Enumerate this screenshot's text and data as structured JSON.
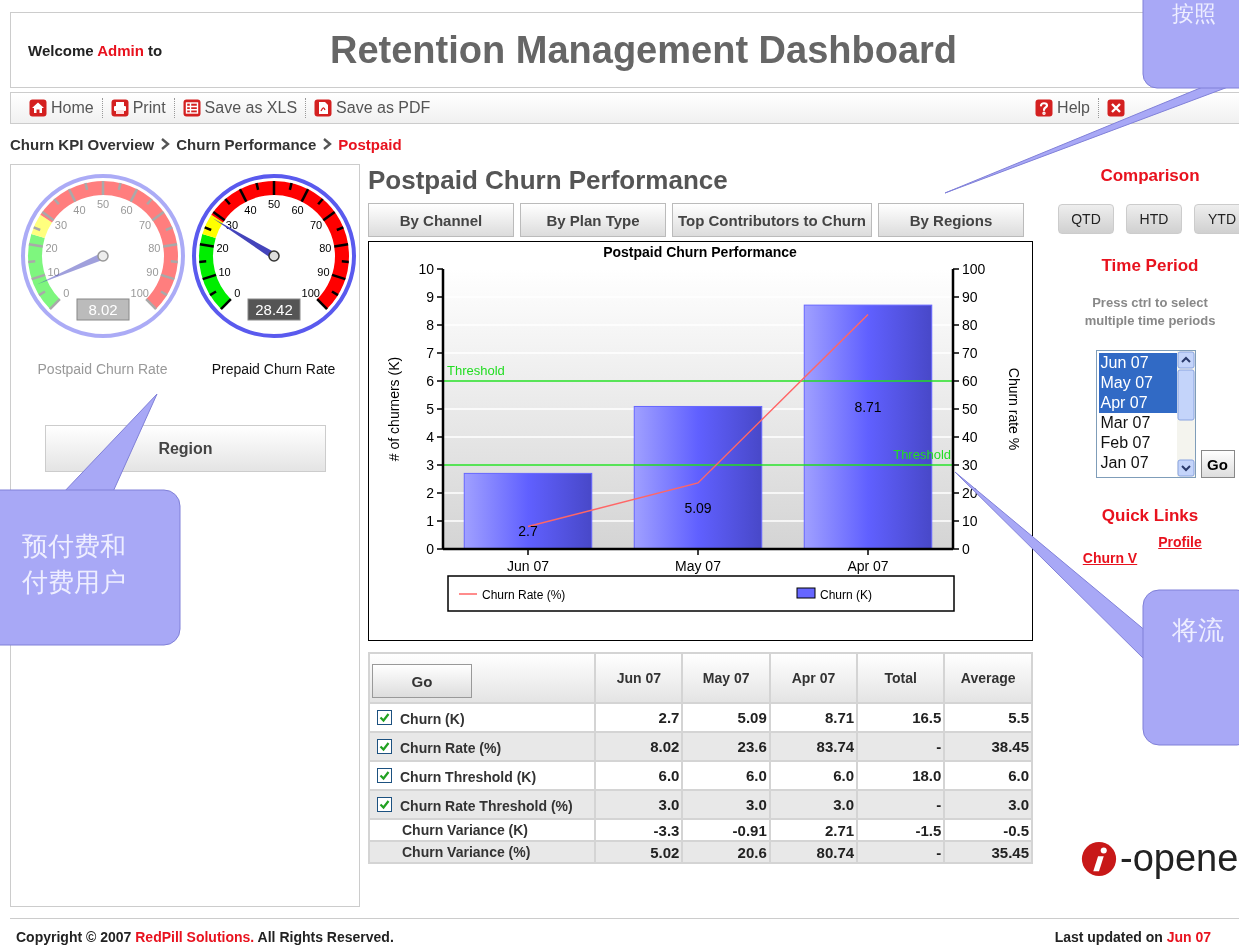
{
  "header": {
    "welcome": {
      "prefix": "Welcome",
      "user": "Admin",
      "suffix": "to"
    },
    "title": "Retention Management Dashboard"
  },
  "toolbar": {
    "left": [
      "Home",
      "Print",
      "Save as XLS",
      "Save as PDF"
    ],
    "right": [
      "Help"
    ]
  },
  "breadcrumb": [
    {
      "label": "Churn KPI Overview",
      "selected": false
    },
    {
      "label": "Churn Performance",
      "selected": false
    },
    {
      "label": "Postpaid",
      "selected": true
    }
  ],
  "gauges": [
    {
      "label": "Postpaid Churn Rate",
      "value": "8.02",
      "dimmed": true,
      "scale": [
        "0",
        "10",
        "20",
        "30",
        "40",
        "50",
        "60",
        "70",
        "80",
        "90",
        "100"
      ]
    },
    {
      "label": "Prepaid Churn Rate",
      "value": "28.42",
      "dimmed": false,
      "scale": [
        "0",
        "10",
        "20",
        "30",
        "40",
        "50",
        "60",
        "70",
        "80",
        "90",
        "100"
      ]
    }
  ],
  "region_button": "Region",
  "main": {
    "title": "Postpaid Churn Performance",
    "tabs": [
      "By Channel",
      "By Plan Type",
      "Top Contributors to Churn",
      "By Regions"
    ],
    "chart": {
      "chart_data": {
        "type": "bar",
        "title": "Postpaid Churn Performance",
        "ylabel": "# of churners (K)",
        "y2label": "Churn rate %",
        "categories": [
          "Jun 07",
          "May 07",
          "Apr 07"
        ],
        "series": [
          {
            "name": "Churn Rate (%)",
            "type": "line",
            "axis": "y2",
            "color": "#ff6666",
            "values": [
              8.02,
              23.6,
              83.74
            ],
            "value_labels": [
              null,
              null,
              null
            ]
          },
          {
            "name": "Churn (K)",
            "type": "bar",
            "color": "#6666ff",
            "values": [
              2.7,
              5.09,
              8.71
            ],
            "value_labels": [
              "2.7",
              "5.09",
              "8.71"
            ]
          }
        ],
        "ylim": [
          0,
          10
        ],
        "yticks": [
          0,
          1,
          2,
          3,
          4,
          5,
          6,
          7,
          8,
          9,
          10
        ],
        "y2lim": [
          0,
          100
        ],
        "y2ticks": [
          0,
          10,
          20,
          30,
          40,
          50,
          60,
          70,
          80,
          90,
          100
        ],
        "grid": true,
        "legend": "bottom"
      },
      "thresholds": [
        {
          "label": "Threshold"
        },
        {
          "label": "Threshold"
        }
      ]
    },
    "table": {
      "corner_button": "Go",
      "columns": [
        "Jun 07",
        "May 07",
        "Apr 07",
        "Total",
        "Average"
      ],
      "rows": [
        {
          "kind": "checkbox",
          "checked": true,
          "label": "Churn (K)",
          "cells": [
            "2.7",
            "5.09",
            "8.71",
            "16.5",
            "5.5"
          ]
        },
        {
          "kind": "checkbox",
          "checked": true,
          "label": "Churn Rate (%)",
          "cells": [
            "8.02",
            "23.6",
            "83.74",
            "-",
            "38.45"
          ]
        },
        {
          "kind": "checkbox",
          "checked": true,
          "label": "Churn Threshold (K)",
          "cells": [
            "6.0",
            "6.0",
            "6.0",
            "18.0",
            "6.0"
          ]
        },
        {
          "kind": "checkbox",
          "checked": true,
          "label": "Churn Rate Threshold (%)",
          "cells": [
            "3.0",
            "3.0",
            "3.0",
            "-",
            "3.0"
          ]
        },
        {
          "kind": "plain",
          "label": "Churn Variance (K)",
          "cells": [
            "-3.3",
            "-0.91",
            "2.71",
            "-1.5",
            "-0.5"
          ]
        },
        {
          "kind": "plain",
          "label": "Churn Variance (%)",
          "cells": [
            "5.02",
            "20.6",
            "80.74",
            "-",
            "35.45"
          ]
        }
      ]
    }
  },
  "right": {
    "comparison": {
      "title": "Comparison",
      "buttons": [
        "QTD",
        "HTD",
        "YTD"
      ]
    },
    "time_period": {
      "title": "Time Period",
      "hint": "Press ctrl to select multiple time periods",
      "options": [
        {
          "label": "Jun 07",
          "selected": true
        },
        {
          "label": "May 07",
          "selected": true
        },
        {
          "label": "Apr 07",
          "selected": true
        },
        {
          "label": "Mar 07",
          "selected": false
        },
        {
          "label": "Feb 07",
          "selected": false
        },
        {
          "label": "Jan 07",
          "selected": false
        }
      ],
      "go": "Go"
    },
    "quick_links": {
      "title": "Quick Links",
      "links": [
        "Profile",
        "Churn V"
      ]
    },
    "logo": "-opene"
  },
  "footer": {
    "copyright": {
      "prefix": "Copyright © 2007",
      "company": "RedPill Solutions.",
      "suffix": "All Rights Reserved."
    },
    "updated": {
      "prefix": "Last updated on",
      "date": "Jun 07"
    }
  },
  "callouts": [
    {
      "lines": [
        "按照"
      ]
    },
    {
      "lines": [
        "预付费和",
        "付费用户"
      ]
    },
    {
      "lines": [
        "将流"
      ]
    }
  ]
}
